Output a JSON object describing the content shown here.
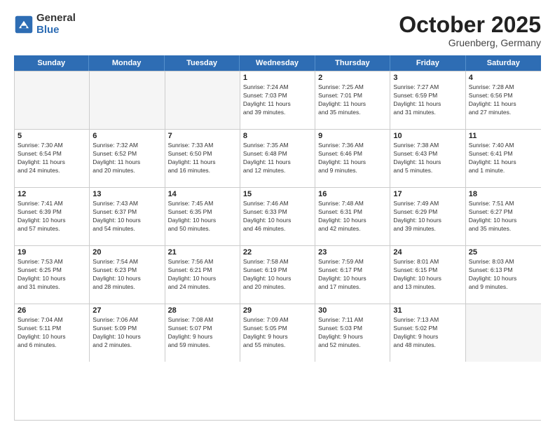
{
  "logo": {
    "general": "General",
    "blue": "Blue"
  },
  "title": "October 2025",
  "subtitle": "Gruenberg, Germany",
  "weekdays": [
    "Sunday",
    "Monday",
    "Tuesday",
    "Wednesday",
    "Thursday",
    "Friday",
    "Saturday"
  ],
  "rows": [
    [
      {
        "day": "",
        "info": ""
      },
      {
        "day": "",
        "info": ""
      },
      {
        "day": "",
        "info": ""
      },
      {
        "day": "1",
        "info": "Sunrise: 7:24 AM\nSunset: 7:03 PM\nDaylight: 11 hours\nand 39 minutes."
      },
      {
        "day": "2",
        "info": "Sunrise: 7:25 AM\nSunset: 7:01 PM\nDaylight: 11 hours\nand 35 minutes."
      },
      {
        "day": "3",
        "info": "Sunrise: 7:27 AM\nSunset: 6:59 PM\nDaylight: 11 hours\nand 31 minutes."
      },
      {
        "day": "4",
        "info": "Sunrise: 7:28 AM\nSunset: 6:56 PM\nDaylight: 11 hours\nand 27 minutes."
      }
    ],
    [
      {
        "day": "5",
        "info": "Sunrise: 7:30 AM\nSunset: 6:54 PM\nDaylight: 11 hours\nand 24 minutes."
      },
      {
        "day": "6",
        "info": "Sunrise: 7:32 AM\nSunset: 6:52 PM\nDaylight: 11 hours\nand 20 minutes."
      },
      {
        "day": "7",
        "info": "Sunrise: 7:33 AM\nSunset: 6:50 PM\nDaylight: 11 hours\nand 16 minutes."
      },
      {
        "day": "8",
        "info": "Sunrise: 7:35 AM\nSunset: 6:48 PM\nDaylight: 11 hours\nand 12 minutes."
      },
      {
        "day": "9",
        "info": "Sunrise: 7:36 AM\nSunset: 6:46 PM\nDaylight: 11 hours\nand 9 minutes."
      },
      {
        "day": "10",
        "info": "Sunrise: 7:38 AM\nSunset: 6:43 PM\nDaylight: 11 hours\nand 5 minutes."
      },
      {
        "day": "11",
        "info": "Sunrise: 7:40 AM\nSunset: 6:41 PM\nDaylight: 11 hours\nand 1 minute."
      }
    ],
    [
      {
        "day": "12",
        "info": "Sunrise: 7:41 AM\nSunset: 6:39 PM\nDaylight: 10 hours\nand 57 minutes."
      },
      {
        "day": "13",
        "info": "Sunrise: 7:43 AM\nSunset: 6:37 PM\nDaylight: 10 hours\nand 54 minutes."
      },
      {
        "day": "14",
        "info": "Sunrise: 7:45 AM\nSunset: 6:35 PM\nDaylight: 10 hours\nand 50 minutes."
      },
      {
        "day": "15",
        "info": "Sunrise: 7:46 AM\nSunset: 6:33 PM\nDaylight: 10 hours\nand 46 minutes."
      },
      {
        "day": "16",
        "info": "Sunrise: 7:48 AM\nSunset: 6:31 PM\nDaylight: 10 hours\nand 42 minutes."
      },
      {
        "day": "17",
        "info": "Sunrise: 7:49 AM\nSunset: 6:29 PM\nDaylight: 10 hours\nand 39 minutes."
      },
      {
        "day": "18",
        "info": "Sunrise: 7:51 AM\nSunset: 6:27 PM\nDaylight: 10 hours\nand 35 minutes."
      }
    ],
    [
      {
        "day": "19",
        "info": "Sunrise: 7:53 AM\nSunset: 6:25 PM\nDaylight: 10 hours\nand 31 minutes."
      },
      {
        "day": "20",
        "info": "Sunrise: 7:54 AM\nSunset: 6:23 PM\nDaylight: 10 hours\nand 28 minutes."
      },
      {
        "day": "21",
        "info": "Sunrise: 7:56 AM\nSunset: 6:21 PM\nDaylight: 10 hours\nand 24 minutes."
      },
      {
        "day": "22",
        "info": "Sunrise: 7:58 AM\nSunset: 6:19 PM\nDaylight: 10 hours\nand 20 minutes."
      },
      {
        "day": "23",
        "info": "Sunrise: 7:59 AM\nSunset: 6:17 PM\nDaylight: 10 hours\nand 17 minutes."
      },
      {
        "day": "24",
        "info": "Sunrise: 8:01 AM\nSunset: 6:15 PM\nDaylight: 10 hours\nand 13 minutes."
      },
      {
        "day": "25",
        "info": "Sunrise: 8:03 AM\nSunset: 6:13 PM\nDaylight: 10 hours\nand 9 minutes."
      }
    ],
    [
      {
        "day": "26",
        "info": "Sunrise: 7:04 AM\nSunset: 5:11 PM\nDaylight: 10 hours\nand 6 minutes."
      },
      {
        "day": "27",
        "info": "Sunrise: 7:06 AM\nSunset: 5:09 PM\nDaylight: 10 hours\nand 2 minutes."
      },
      {
        "day": "28",
        "info": "Sunrise: 7:08 AM\nSunset: 5:07 PM\nDaylight: 9 hours\nand 59 minutes."
      },
      {
        "day": "29",
        "info": "Sunrise: 7:09 AM\nSunset: 5:05 PM\nDaylight: 9 hours\nand 55 minutes."
      },
      {
        "day": "30",
        "info": "Sunrise: 7:11 AM\nSunset: 5:03 PM\nDaylight: 9 hours\nand 52 minutes."
      },
      {
        "day": "31",
        "info": "Sunrise: 7:13 AM\nSunset: 5:02 PM\nDaylight: 9 hours\nand 48 minutes."
      },
      {
        "day": "",
        "info": ""
      }
    ]
  ]
}
